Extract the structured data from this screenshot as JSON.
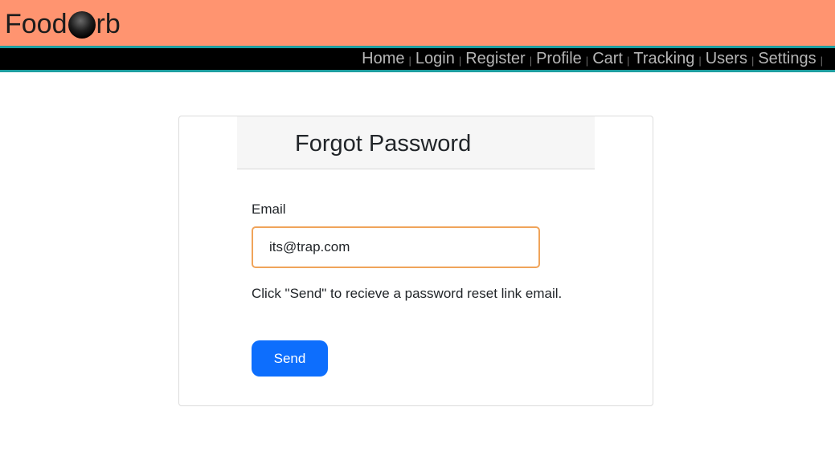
{
  "brand": {
    "name_before": "Food",
    "name_after": "rb",
    "logo_icon": "orb-icon",
    "header_color": "#ff9470",
    "accent_line_color": "#1f9ea0"
  },
  "nav": {
    "items": [
      {
        "label": "Home"
      },
      {
        "label": "Login"
      },
      {
        "label": "Register"
      },
      {
        "label": "Profile"
      },
      {
        "label": "Cart"
      },
      {
        "label": "Tracking"
      },
      {
        "label": "Users"
      },
      {
        "label": "Settings"
      }
    ],
    "separator": "|"
  },
  "form": {
    "title": "Forgot Password",
    "email_label": "Email",
    "email_value": "its@trap.com",
    "help_text": "Click \"Send\" to recieve a password reset link email.",
    "send_label": "Send",
    "send_color": "#0d6efd",
    "input_focus_color": "#f0a45a"
  }
}
